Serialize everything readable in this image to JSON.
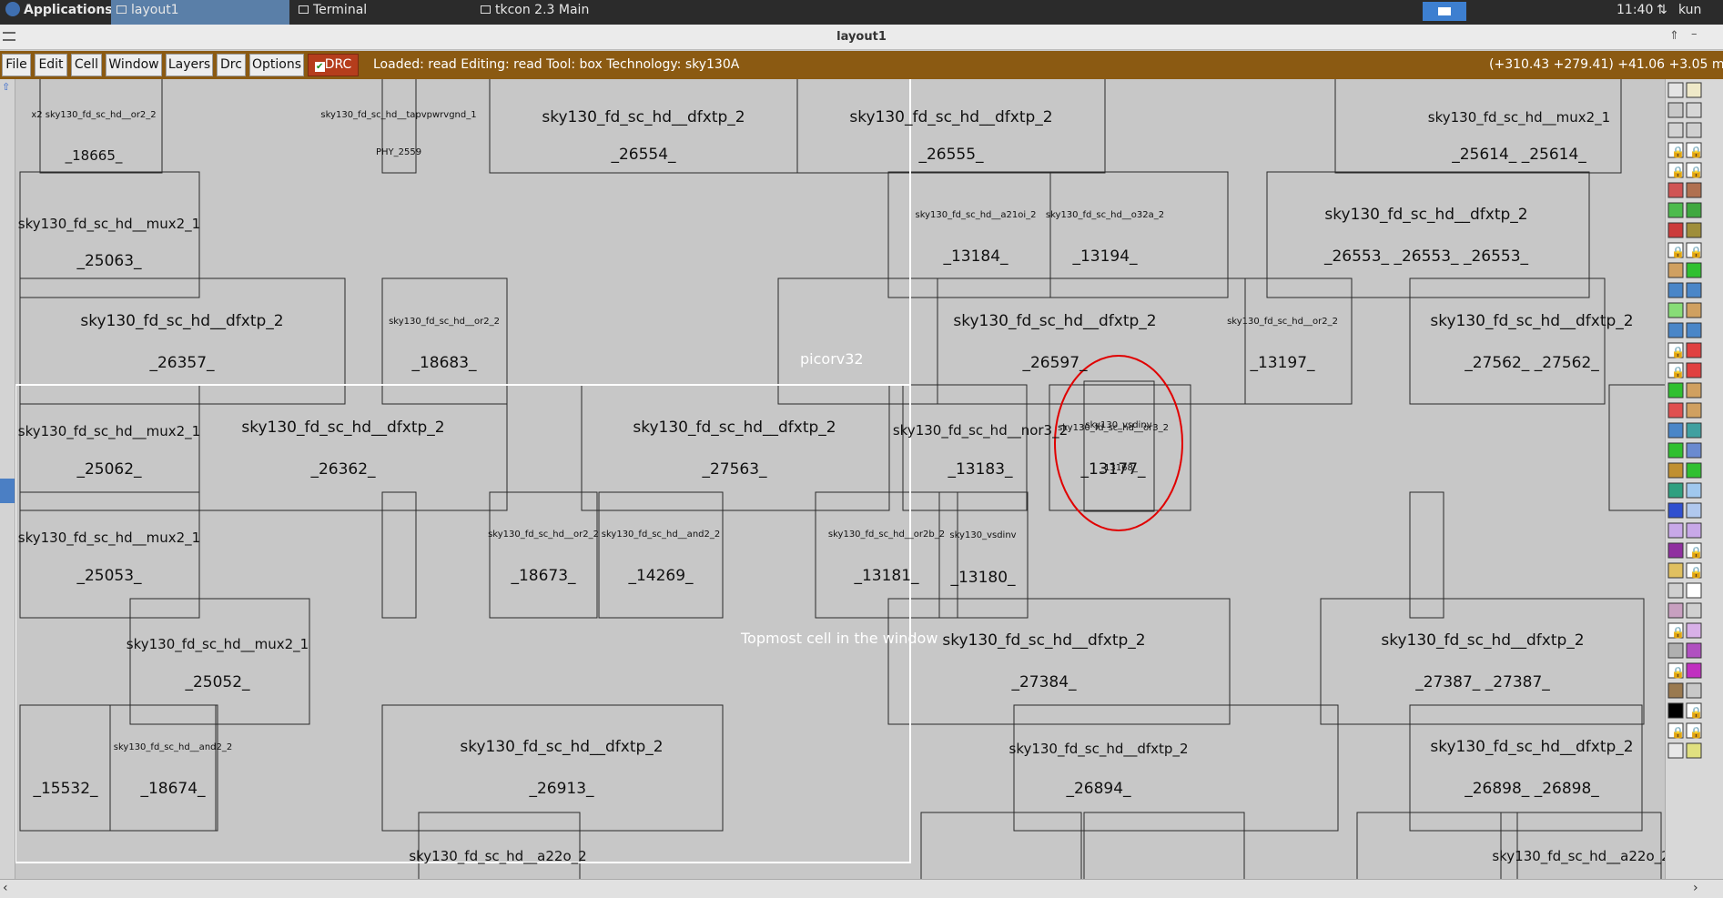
{
  "taskbar": {
    "applications": "Applications",
    "tabs": [
      "layout1",
      "Terminal",
      "tkcon 2.3 Main"
    ],
    "clock": "11:40",
    "user": "kun"
  },
  "window": {
    "title": "layout1"
  },
  "menubar": {
    "menus": [
      "File",
      "Edit",
      "Cell",
      "Window",
      "Layers",
      "Drc",
      "Options"
    ],
    "drc_label": "DRC",
    "status": "Loaded: read Editing: read Tool: box  Technology: sky130A",
    "coords": "(+310.43 +279.41) +41.06 +3.05 m"
  },
  "canvas": {
    "overlay_labels": [
      "Topmost cell in the window",
      "picorv32"
    ],
    "cells": [
      {
        "type": "x2 sky130_fd_sc_hd__or2_2",
        "name": "_18665_"
      },
      {
        "type": "sky130_fd_sc_hd__tapvpwrvgnd_1",
        "name": "PHY_2559"
      },
      {
        "type": "sky130_fd_sc_hd__dfxtp_2",
        "name": "_26554_"
      },
      {
        "type": "sky130_fd_sc_hd__dfxtp_2",
        "name": "_26555_"
      },
      {
        "type": "sky130_fd_sc_hd__mux2_1",
        "name": "_25614_ _25614_"
      },
      {
        "type": "sky130_fd_sc_hd__mux2_1",
        "name": "_25063_"
      },
      {
        "type": "sky130_fd_sc_hd__a21oi_2",
        "name": "_13184_"
      },
      {
        "type": "sky130_fd_sc_hd__o32a_2",
        "name": "_13194_"
      },
      {
        "type": "sky130_fd_sc_hd__dfxtp_2",
        "name": "_26553_ _26553_ _26553_"
      },
      {
        "type": "sky130_fd_sc_hd__dfxtp_2",
        "name": "_26357_"
      },
      {
        "type": "sky130_fd_sc_hd__or2_2",
        "name": "_18683_"
      },
      {
        "type": "sky130_fd_sc_hd__dfxtp_2",
        "name": "_26597_"
      },
      {
        "type": "sky130_fd_sc_hd__or2_2",
        "name": "_13197_"
      },
      {
        "type": "sky130_fd_sc_hd__dfxtp_2",
        "name": "_27562_ _27562_"
      },
      {
        "type": "sky130_fd_sc_hd__mux2_1",
        "name": "_25062_"
      },
      {
        "type": "sky130_fd_sc_hd__dfxtp_2",
        "name": "_26362_"
      },
      {
        "type": "sky130_fd_sc_hd__dfxtp_2",
        "name": "_27563_"
      },
      {
        "type": "sky130_fd_sc_hd__nor3_2",
        "name": "_13183_"
      },
      {
        "type": "sky130_fd_sc_hd__or3_2",
        "name": "_13177_"
      },
      {
        "type": "sky130_vsdinv",
        "name": "_13168_"
      },
      {
        "type": "sky130_fd_sc_hd__mux2_1",
        "name": "_25053_"
      },
      {
        "type": "sky130_fd_sc_hd__or2_2",
        "name": "_18673_"
      },
      {
        "type": "sky130_fd_sc_hd__and2_2",
        "name": "_14269_"
      },
      {
        "type": "sky130_fd_sc_hd__or2b_2",
        "name": "_13181_"
      },
      {
        "type": "sky130_vsdinv",
        "name": "_13180_"
      },
      {
        "type": "sky130_fd_sc_hd__mux2_1",
        "name": "_25052_"
      },
      {
        "type": "sky130_fd_sc_hd__dfxtp_2",
        "name": "_27384_"
      },
      {
        "type": "sky130_fd_sc_hd__dfxtp_2",
        "name": "_27387_ _27387_"
      },
      {
        "type": "sky130_fd_sc_hd__and2_2",
        "name": "_18674_"
      },
      {
        "type": "sky130_fd_sc_hd__dfxtp_2",
        "name": "_26913_"
      },
      {
        "type": "sky130_fd_sc_hd__dfxtp_2",
        "name": "_26894_"
      },
      {
        "type": "sky130_fd_sc_hd__dfxtp_2",
        "name": "_26898_ _26898_"
      },
      {
        "type": "sky130_fd_sc_hd__mux2_1",
        "name": "_15532_"
      },
      {
        "type": "sky130_fd_sc_hd__a22o_2",
        "name": ""
      },
      {
        "type": "sky130_fd_sc_hd__a22o_2",
        "name": ""
      }
    ]
  },
  "colors": {
    "menubar": "#8b5a12",
    "highlight": "#e00000",
    "canvas": "#c7c7c7"
  }
}
